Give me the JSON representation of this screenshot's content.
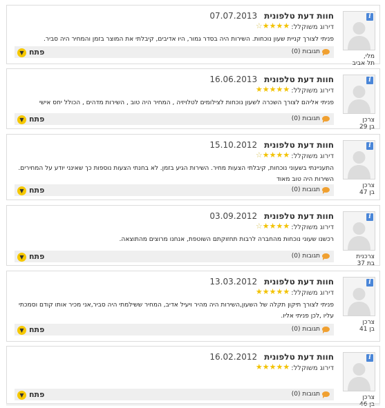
{
  "labels": {
    "rating_label": "דירוג משוקלל:",
    "replies": "תגובות (0)",
    "open": "פתח"
  },
  "colors": {
    "star": "#f2c200",
    "open_button": "#f6c800",
    "info_icon": "#4a86d8"
  },
  "reviews": [
    {
      "title": "חוות דעת טלפונית",
      "date": "07.07.2013",
      "rating": 4.5,
      "text": "פניתי לצורך קניית שעון נוכחות. השירות היה בסדר גמור, היו אדיבים, קיבלתי את המוצר בזמן והמחיר היה סביר.",
      "user_line1": "מלי,",
      "user_line2": "תל אביב"
    },
    {
      "title": "חוות דעת טלפונית",
      "date": "16.06.2013",
      "rating": 5,
      "text": "פניתי אליהם לצורך השכרה לשעון נוכחות לצילומים לטלויזיה , המחיר היה טוב , השירות מדהים , הכולל יחס אישי",
      "user_line1": "צרכן",
      "user_line2": "בן 29"
    },
    {
      "title": "חוות דעת טלפונית",
      "date": "15.10.2012",
      "rating": 4.5,
      "text": "התעניינתי בשעוני נוכחות, קיבלתי הצעות מחיר. השירות הגיע בזמן. לא בחנתי הצעות נוספות כך שאינני יודע על המחירים. השירות היה טוב מאוד",
      "user_line1": "צרכן",
      "user_line2": "בן 47"
    },
    {
      "title": "חוות דעת טלפונית",
      "date": "03.09.2012",
      "rating": 4.5,
      "text": "רכשנו שעוני נוכחות מהחברה לרבות תחזוקתם השוטפת, אנחנו מרוצים מהתוצאה.",
      "user_line1": "צרכנית",
      "user_line2": "בת 37"
    },
    {
      "title": "חוות דעת טלפונית",
      "date": "13.03.2012",
      "rating": 5,
      "text": "פניתי לצורך תיקון תקלה של השעון,השירות היה מהיר ויעיל אדיב, המחיר ששילמתי היה סביר,אני מכיר אותו קודם וסמכתי עליו ,לכן פניתי אליו.",
      "user_line1": "צרכן",
      "user_line2": "בן 41"
    },
    {
      "title": "חוות דעת טלפונית",
      "date": "16.02.2012",
      "rating": 5,
      "text": "",
      "user_line1": "צרכן",
      "user_line2": "בן 46"
    }
  ]
}
